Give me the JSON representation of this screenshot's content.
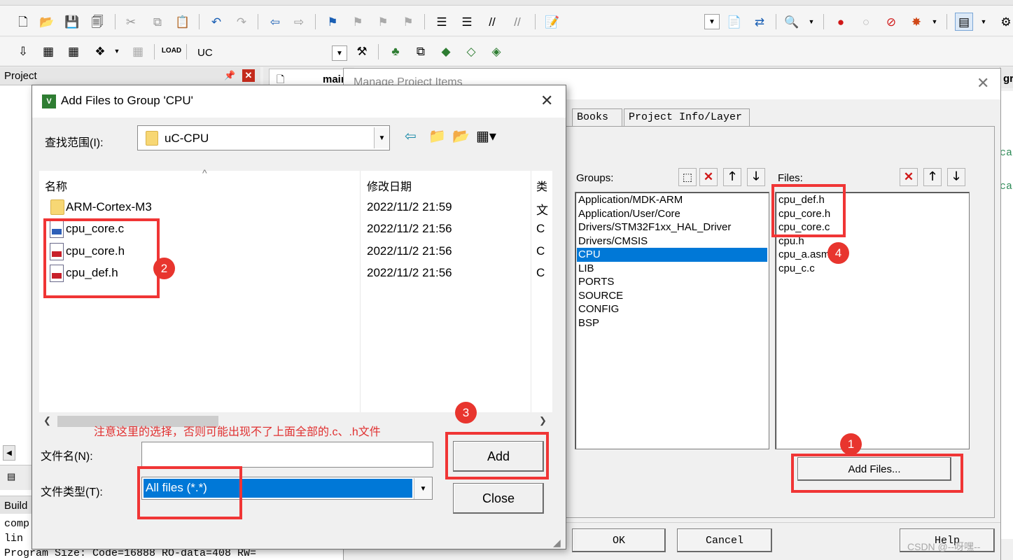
{
  "colors": {
    "accent": "#0078d7",
    "annotation_red": "#f03535",
    "note_red": "#e03030",
    "delete_x_red": "#d01818"
  },
  "ide": {
    "target_label": "UC",
    "project_pane": {
      "title": "Project"
    },
    "editor_tab": {
      "label": "main"
    },
    "right_tab_stub": "gr",
    "code_fragments": [
      "ca",
      "ca"
    ],
    "build_panel": {
      "title": "Build",
      "lines": [
        "comp",
        "lin",
        "Program Size: Code=16888 RO-data=408 RW="
      ]
    }
  },
  "manage_dialog": {
    "title": "Manage Project Items",
    "tabs": [
      "Books",
      "Project Info/Layer"
    ],
    "groups_label": "Groups:",
    "groups": [
      "Application/MDK-ARM",
      "Application/User/Core",
      "Drivers/STM32F1xx_HAL_Driver",
      "Drivers/CMSIS",
      "CPU",
      "LIB",
      "PORTS",
      "SOURCE",
      "CONFIG",
      "BSP"
    ],
    "selected_group": "CPU",
    "files_label": "Files:",
    "files": [
      "cpu_def.h",
      "cpu_core.h",
      "cpu_core.c",
      "cpu.h",
      "cpu_a.asm",
      "cpu_c.c"
    ],
    "add_files_button": "Add Files...",
    "ok_button": "OK",
    "cancel_button": "Cancel",
    "help_button": "Help"
  },
  "add_files_dialog": {
    "title": "Add Files to Group 'CPU'",
    "look_in_label": "查找范围(I):",
    "look_in_value": "uC-CPU",
    "columns": {
      "name": "名称",
      "date": "修改日期",
      "type": "类"
    },
    "rows": [
      {
        "name": "ARM-Cortex-M3",
        "date": "2022/11/2 21:59",
        "type": "文"
      },
      {
        "name": "cpu_core.c",
        "date": "2022/11/2 21:56",
        "type": "C"
      },
      {
        "name": "cpu_core.h",
        "date": "2022/11/2 21:56",
        "type": "C"
      },
      {
        "name": "cpu_def.h",
        "date": "2022/11/2 21:56",
        "type": "C"
      }
    ],
    "note": "注意这里的选择，否则可能出现不了上面全部的.c、.h文件",
    "filename_label": "文件名(N):",
    "filename_value": "",
    "filetype_label": "文件类型(T):",
    "filetype_value": "All files (*.*)",
    "add_button": "Add",
    "close_button": "Close"
  },
  "annotations": [
    "1",
    "2",
    "3",
    "4"
  ],
  "watermark": "CSDN @--呀嘿--"
}
